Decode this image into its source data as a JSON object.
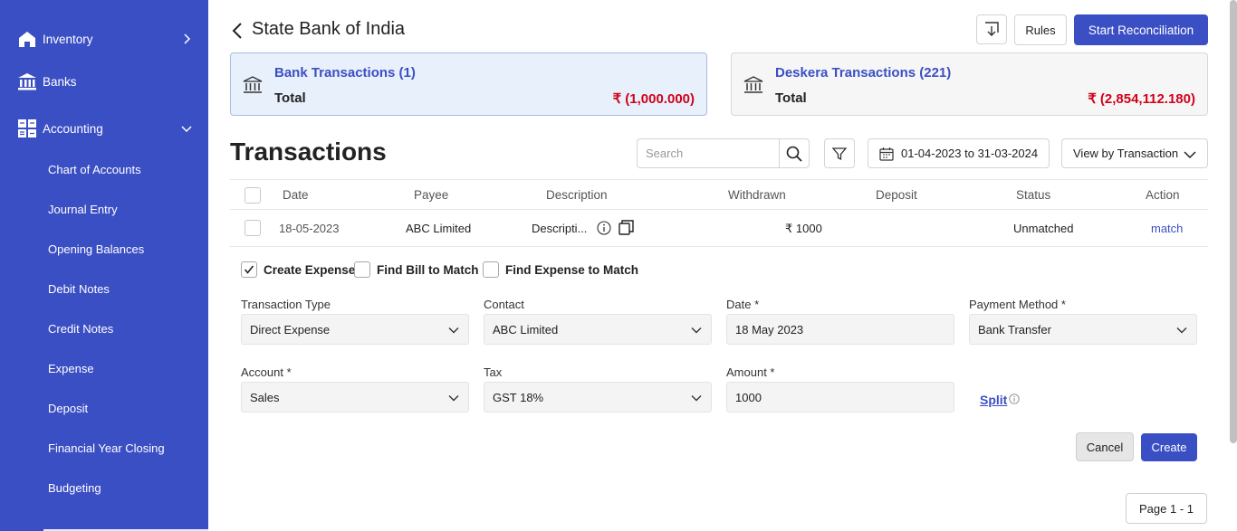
{
  "sidebar": {
    "items": [
      {
        "label": "Inventory",
        "icon": "home-icon",
        "expanded": false
      },
      {
        "label": "Banks",
        "icon": "bank-icon"
      },
      {
        "label": "Accounting",
        "icon": "grid-icon",
        "expanded": true
      }
    ],
    "accounting_sub": [
      "Chart of Accounts",
      "Journal Entry",
      "Opening Balances",
      "Debit Notes",
      "Credit Notes",
      "Expense",
      "Deposit",
      "Financial Year Closing",
      "Budgeting"
    ]
  },
  "header": {
    "title": "State Bank of India",
    "rules_label": "Rules",
    "reconcile_label": "Start Reconciliation"
  },
  "cards": {
    "bank": {
      "title": "Bank Transactions (1)",
      "total_label": "Total",
      "total_value": "₹ (1,000.000)"
    },
    "deskera": {
      "title": "Deskera Transactions (221)",
      "total_label": "Total",
      "total_value": "₹ (2,854,112.180)"
    }
  },
  "transactions": {
    "title": "Transactions",
    "search_placeholder": "Search",
    "date_range": "01-04-2023 to 31-03-2024",
    "view_by": "View by Transaction",
    "columns": [
      "Date",
      "Payee",
      "Description",
      "Withdrawn",
      "Deposit",
      "Status",
      "Action"
    ],
    "rows": [
      {
        "date": "18-05-2023",
        "payee": "ABC Limited",
        "description": "Descripti...",
        "withdrawn": "₹ 1000",
        "deposit": "",
        "status": "Unmatched",
        "action": "match"
      }
    ]
  },
  "expense_options": [
    {
      "label": "Create Expense",
      "checked": true
    },
    {
      "label": "Find Bill to Match",
      "checked": false
    },
    {
      "label": "Find Expense to Match",
      "checked": false
    }
  ],
  "form": {
    "transaction_type": {
      "label": "Transaction Type",
      "value": "Direct Expense"
    },
    "contact": {
      "label": "Contact",
      "value": "ABC Limited"
    },
    "date": {
      "label": "Date *",
      "value": "18 May 2023"
    },
    "payment_method": {
      "label": "Payment Method *",
      "value": "Bank Transfer"
    },
    "account": {
      "label": "Account *",
      "value": "Sales"
    },
    "tax": {
      "label": "Tax",
      "value": "GST 18%"
    },
    "amount": {
      "label": "Amount *",
      "value": "1000"
    },
    "split_label": "Split",
    "cancel_label": "Cancel",
    "create_label": "Create"
  },
  "pager": "Page 1 - 1",
  "colors": {
    "primary": "#3b4fc4",
    "negative": "#d0021b",
    "card_active_bg": "#e8f0fb"
  }
}
